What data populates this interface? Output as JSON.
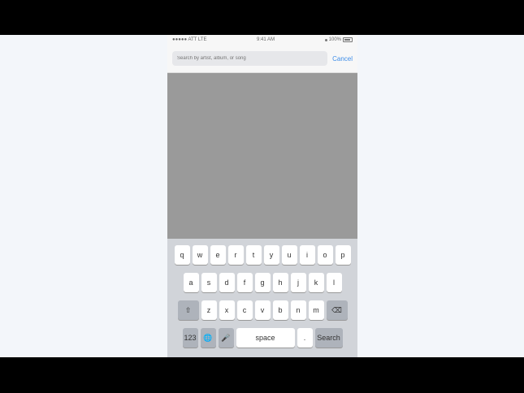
{
  "status": {
    "carrier": "●●●●● ATT LTE",
    "time": "9:41 AM",
    "battery": "100%"
  },
  "search": {
    "placeholder": "Search by artist, album, or song",
    "cancel_label": "Cancel"
  },
  "keyboard": {
    "row1": [
      "q",
      "w",
      "e",
      "r",
      "t",
      "y",
      "u",
      "i",
      "o",
      "p"
    ],
    "row2": [
      "a",
      "s",
      "d",
      "f",
      "g",
      "h",
      "j",
      "k",
      "l"
    ],
    "row3": [
      "z",
      "x",
      "c",
      "v",
      "b",
      "n",
      "m"
    ],
    "space_label": "space",
    "return_label": "Search"
  }
}
